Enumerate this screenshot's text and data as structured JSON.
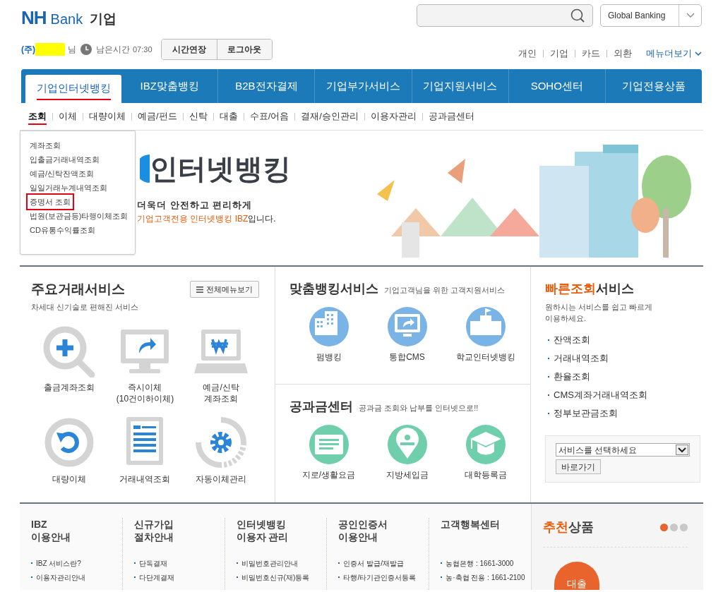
{
  "header": {
    "logo_mark": "NH",
    "logo_bank": "Bank",
    "logo_section": "기업",
    "global_banking": "Global Banking"
  },
  "session": {
    "prefix": "(주)",
    "suffix": "님",
    "remaining_label": "남은시간",
    "remaining_time": "07:30",
    "buttons": [
      "시간연장",
      "로그아웃"
    ]
  },
  "top_links": [
    "개인",
    "기업",
    "카드",
    "외환"
  ],
  "more_menu": "메뉴더보기",
  "main_tabs": [
    {
      "label": "기업인터넷뱅킹",
      "selected": true
    },
    {
      "label": "IBZ맞춤뱅킹",
      "selected": false
    },
    {
      "label": "B2B전자결제",
      "selected": false
    },
    {
      "label": "기업부가서비스",
      "selected": false
    },
    {
      "label": "기업지원서비스",
      "selected": false
    },
    {
      "label": "SOHO센터",
      "selected": false
    },
    {
      "label": "기업전용상품",
      "selected": false
    }
  ],
  "sub_tabs": [
    {
      "label": "조회",
      "selected": true
    },
    {
      "label": "이체",
      "selected": false
    },
    {
      "label": "대량이체",
      "selected": false
    },
    {
      "label": "예금/펀드",
      "selected": false
    },
    {
      "label": "신탁",
      "selected": false
    },
    {
      "label": "대출",
      "selected": false
    },
    {
      "label": "수표/어음",
      "selected": false
    },
    {
      "label": "결재/승인관리",
      "selected": false
    },
    {
      "label": "이용자관리",
      "selected": false
    },
    {
      "label": "공과금센터",
      "selected": false
    }
  ],
  "dropdown_menu": [
    {
      "label": "계좌조회",
      "selected": false
    },
    {
      "label": "입출금거래내역조회",
      "selected": false
    },
    {
      "label": "예금/신탁잔액조회",
      "selected": false
    },
    {
      "label": "일일거래누계내역조회",
      "selected": false
    },
    {
      "label": "증명서 조회",
      "selected": true
    },
    {
      "label": "법원(보관금등)타행이체조회",
      "selected": false
    },
    {
      "label": "CD유통수익률조회",
      "selected": false
    }
  ],
  "hero": {
    "title": "인터넷뱅킹",
    "subtitle": "더욱더 안전하고 편리하게",
    "highlight": "기업고객전용 인터넷뱅킹 IBZ",
    "tail": "입니다."
  },
  "main_services": {
    "title": "주요거래서비스",
    "subtitle": "차세대 신기술로 편해진 서비스",
    "all_menu_button": "전체메뉴보기",
    "items": [
      {
        "kind": "search",
        "label": "출금계좌조회"
      },
      {
        "kind": "monitor",
        "label": "즉시이체\n(10건이하이체)"
      },
      {
        "kind": "laptop",
        "label": "예금/신탁\n계좌조회"
      },
      {
        "kind": "undo",
        "label": "대량이체"
      },
      {
        "kind": "document",
        "label": "거래내역조회"
      },
      {
        "kind": "gear",
        "label": "자동이체관리"
      }
    ]
  },
  "custom_banking": {
    "title": "맞춤뱅킹서비스",
    "subtitle": "기업고객님을 위한 고객지원서비스",
    "items": [
      {
        "kind": "buildings",
        "label": "펌뱅킹"
      },
      {
        "kind": "monitor",
        "label": "통합CMS"
      },
      {
        "kind": "school",
        "label": "학교인터넷뱅킹"
      }
    ]
  },
  "utility_center": {
    "title": "공과금센터",
    "subtitle": "공과금 조회와 납부를 인터넷으로!!",
    "items": [
      {
        "kind": "bill",
        "label": "지로/생활요금"
      },
      {
        "kind": "tax",
        "label": "지방세입금"
      },
      {
        "kind": "cap",
        "label": "대학등록금"
      }
    ]
  },
  "quick_lookup": {
    "title_accent": "빠른조회",
    "title_rest": "서비스",
    "description": "원하시는 서비스를 쉽고 빠르게\n이용하세요.",
    "links": [
      "잔액조회",
      "거래내역조회",
      "환율조회",
      "CMS계좌거래내역조회",
      "정부보관금조회"
    ],
    "select": "서비스를 선택하세요",
    "go_button": "바로가기"
  },
  "footer_columns": [
    {
      "title": "IBZ\n이용안내",
      "links": [
        "IBZ 서비스란?",
        "이용자관리안내"
      ]
    },
    {
      "title": "신규가입\n절차안내",
      "links": [
        "단독결재",
        "다단계결재"
      ]
    },
    {
      "title": "인터넷뱅킹\n이용자 관리",
      "links": [
        "비밀번호관리안내",
        "비밀번호신규(재)등록"
      ]
    },
    {
      "title": "공인인증서\n이용안내",
      "links": [
        "인증서 발급/재발급",
        "타행/타기관인증서등록"
      ]
    },
    {
      "title": "고객행복센터",
      "links": [
        "농협은행 : 1661-3000",
        "농·축협 전용 : 1661-2100"
      ]
    }
  ],
  "recommended": {
    "title_accent": "추천",
    "title_rest": "상품",
    "dots": [
      {
        "selected": true
      },
      {
        "selected": false
      },
      {
        "selected": false
      }
    ],
    "badge": "대출"
  }
}
